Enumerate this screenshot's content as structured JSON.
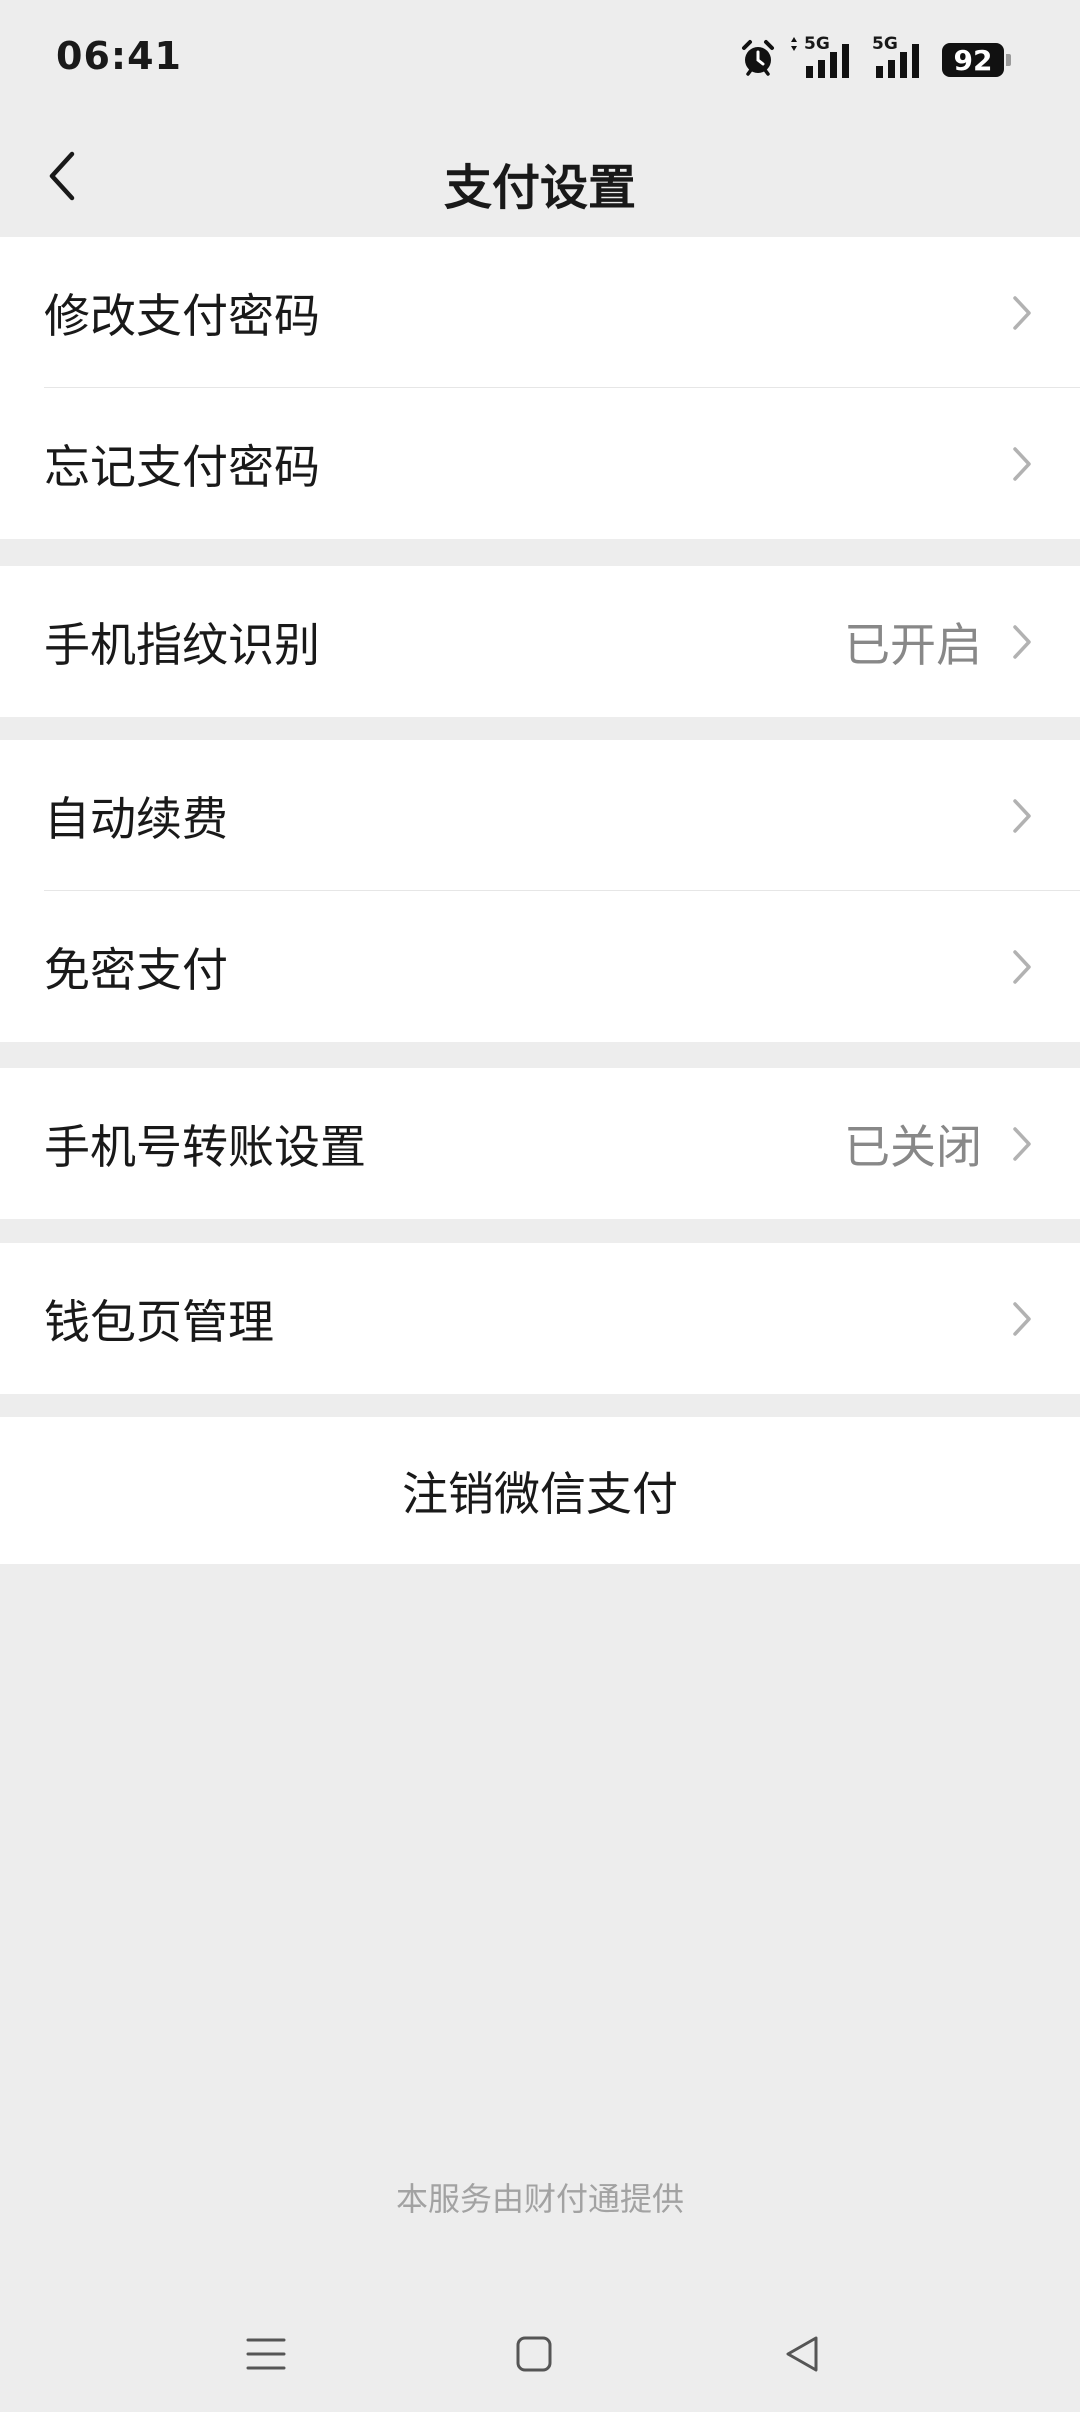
{
  "status_bar": {
    "time": "06:41",
    "network1": "5G",
    "network2": "5G",
    "battery": "92",
    "icons": [
      "alarm-icon",
      "signal-icon",
      "signal-icon",
      "battery-icon"
    ]
  },
  "header": {
    "title": "支付设置",
    "back_icon": "back-chevron-icon"
  },
  "groups": [
    {
      "items": [
        {
          "label": "修改支付密码",
          "value": ""
        },
        {
          "label": "忘记支付密码",
          "value": ""
        }
      ]
    },
    {
      "items": [
        {
          "label": "手机指纹识别",
          "value": "已开启"
        }
      ]
    },
    {
      "items": [
        {
          "label": "自动续费",
          "value": ""
        },
        {
          "label": "免密支付",
          "value": ""
        }
      ]
    },
    {
      "items": [
        {
          "label": "手机号转账设置",
          "value": "已关闭"
        }
      ]
    },
    {
      "items": [
        {
          "label": "钱包页管理",
          "value": ""
        }
      ]
    }
  ],
  "deregister": {
    "label": "注销微信支付"
  },
  "footer": {
    "text": "本服务由财付通提供"
  },
  "system_nav": {
    "icons": [
      "menu-icon",
      "home-icon",
      "back-icon"
    ]
  },
  "colors": {
    "background": "#ededed",
    "card": "#ffffff",
    "text": "#191919",
    "secondary": "#888888",
    "chevron": "#b2b2b2"
  }
}
